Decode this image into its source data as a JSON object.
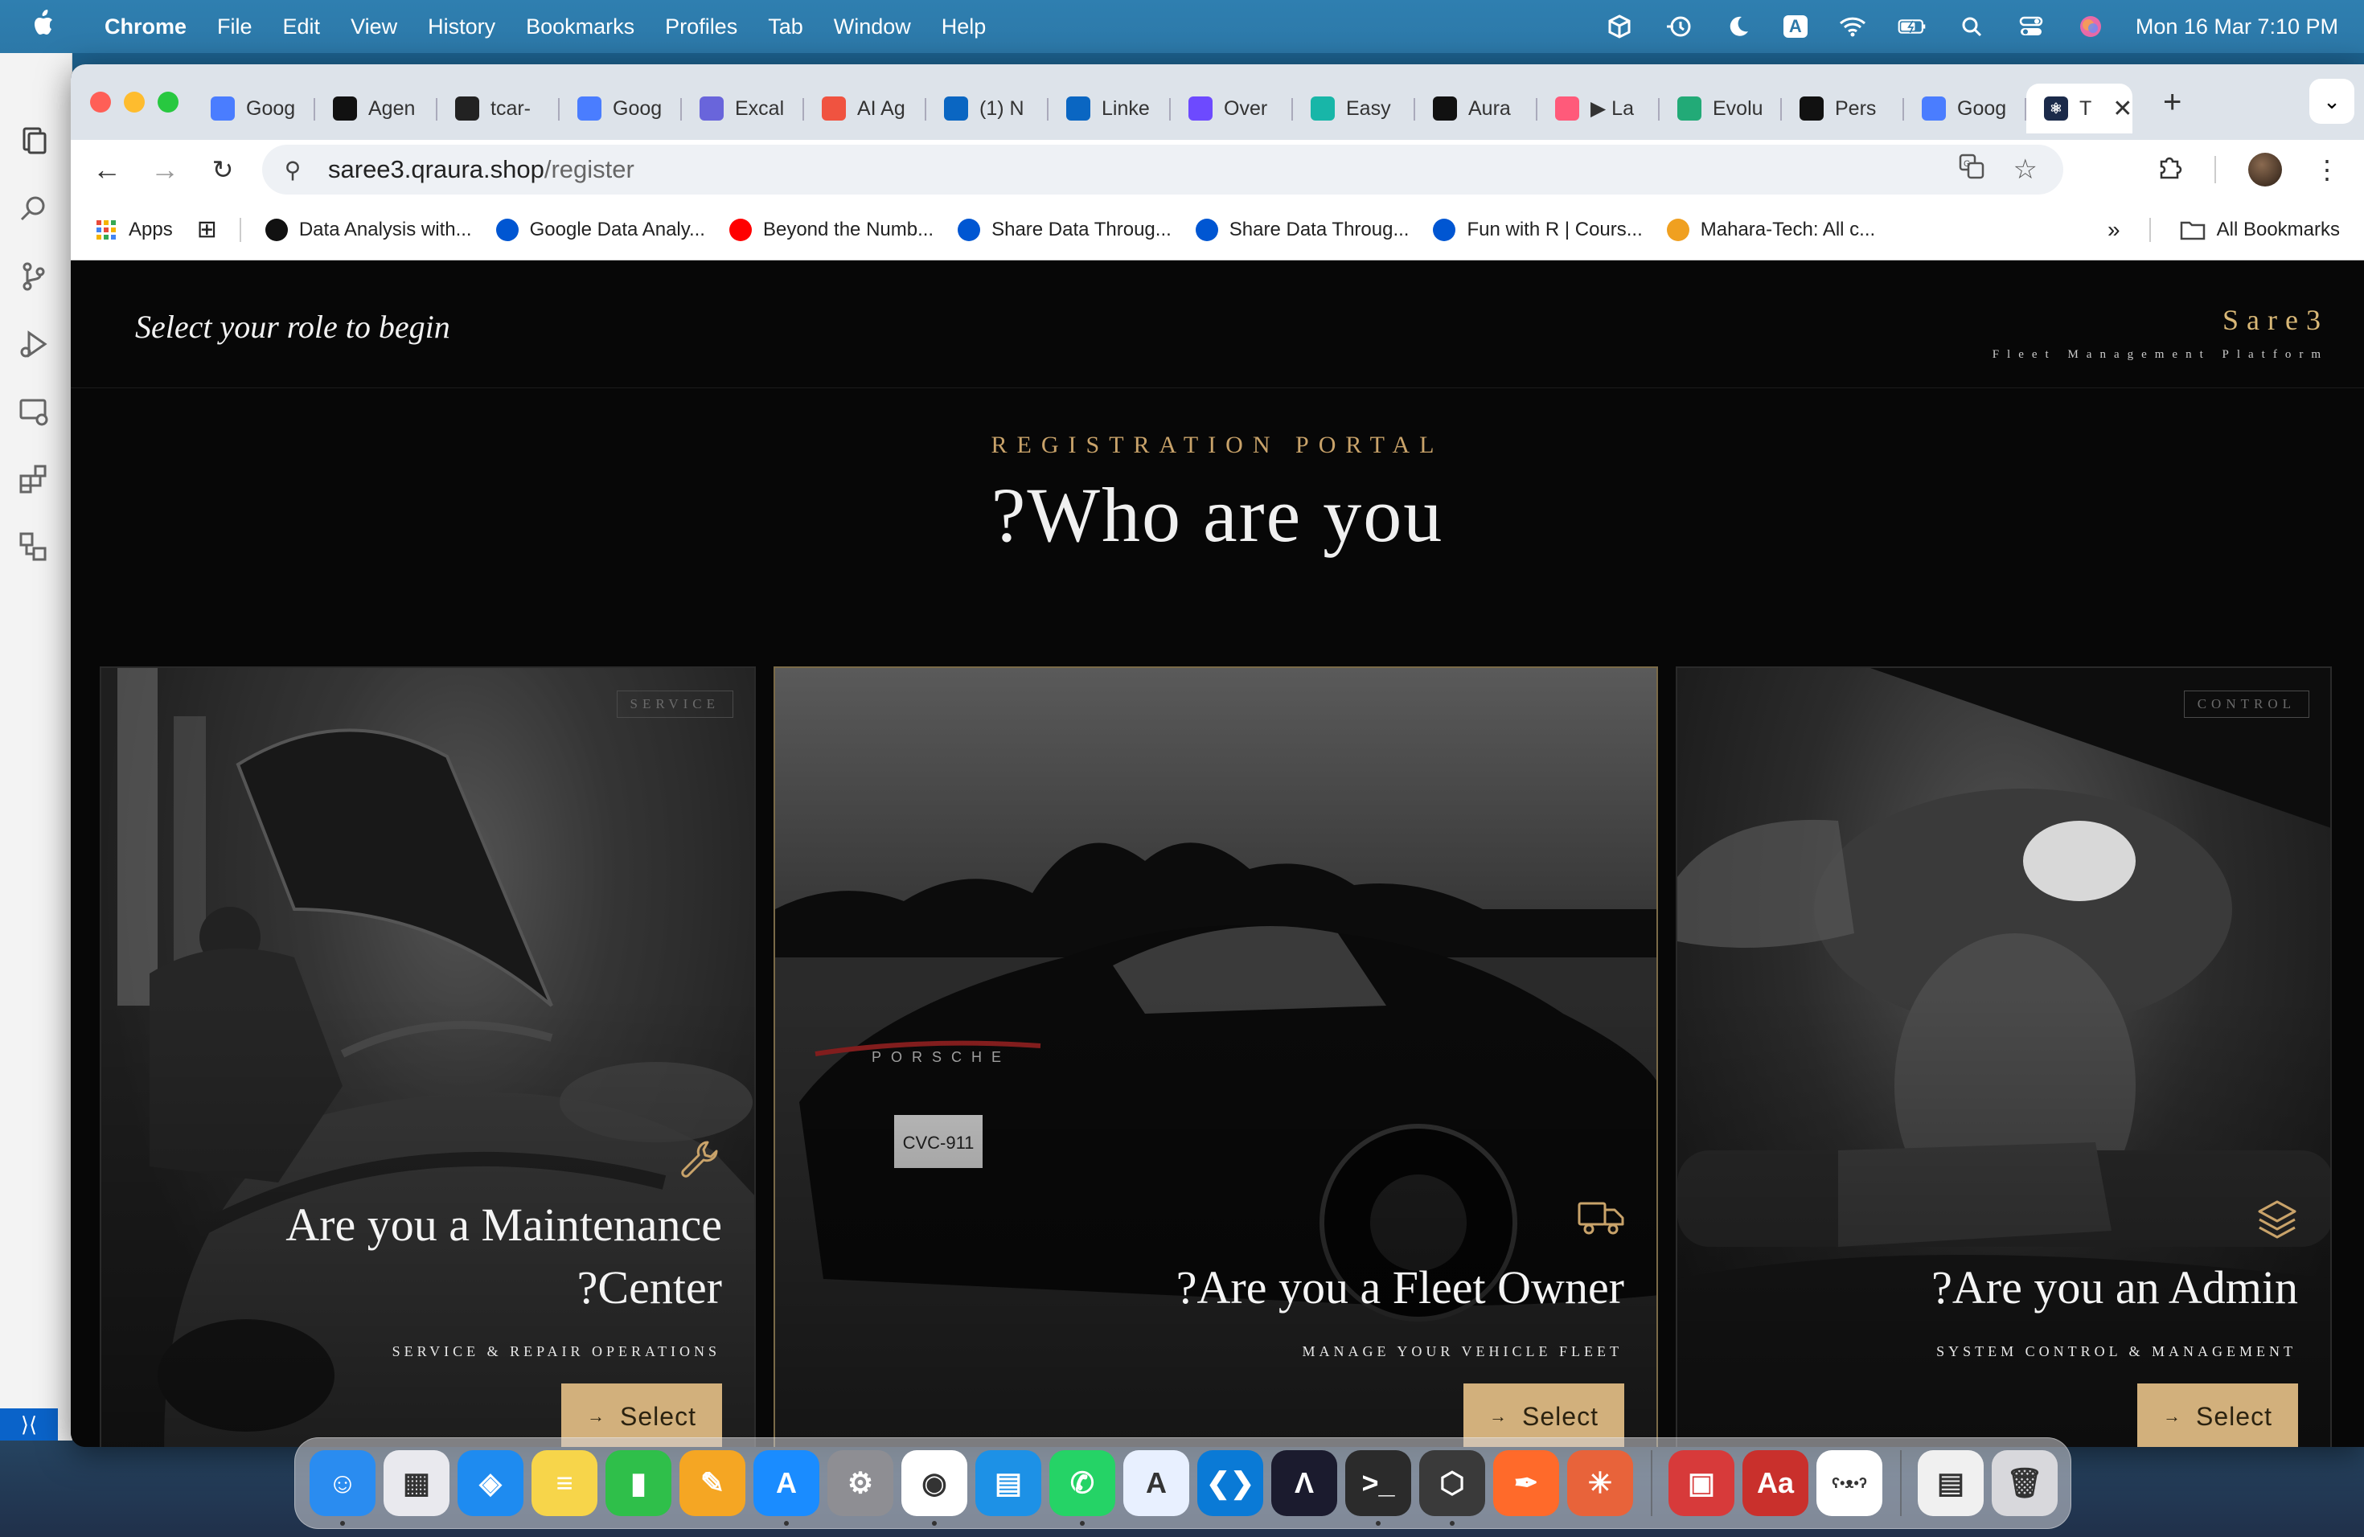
{
  "menubar": {
    "app_name": "Chrome",
    "items": [
      "File",
      "Edit",
      "View",
      "History",
      "Bookmarks",
      "Profiles",
      "Tab",
      "Window",
      "Help"
    ],
    "input_indicator": "A",
    "datetime": "Mon 16 Mar  7:10 PM"
  },
  "tabs": [
    {
      "label": "Goog",
      "icon": "gemini-icon",
      "color": "#4a7dff"
    },
    {
      "label": "Agen",
      "icon": "triangle-logo-icon",
      "color": "#111111"
    },
    {
      "label": "tcar-",
      "icon": "stripes-icon",
      "color": "#222222"
    },
    {
      "label": "Goog",
      "icon": "gemini-icon",
      "color": "#4a7dff"
    },
    {
      "label": "Excal",
      "icon": "excalidraw-icon",
      "color": "#6965db"
    },
    {
      "label": "AI Ag",
      "icon": "laravel-icon",
      "color": "#f05340"
    },
    {
      "label": "(1) N",
      "icon": "linkedin-icon",
      "color": "#0a66c2"
    },
    {
      "label": "Linke",
      "icon": "linkedin-icon",
      "color": "#0a66c2"
    },
    {
      "label": "Over",
      "icon": "make-icon",
      "color": "#6d4aff"
    },
    {
      "label": "Easy",
      "icon": "easy-icon",
      "color": "#18b6a8"
    },
    {
      "label": "Aura",
      "icon": "triangle-logo-icon",
      "color": "#111111"
    },
    {
      "label": "▶ La",
      "icon": "link-icon",
      "color": "#ff5a7a"
    },
    {
      "label": "Evolu",
      "icon": "evolu-icon",
      "color": "#22aa77"
    },
    {
      "label": "Pers",
      "icon": "github-icon",
      "color": "#111111"
    },
    {
      "label": "Goog",
      "icon": "gemini-icon",
      "color": "#4a7dff"
    }
  ],
  "active_tab": {
    "label": "T",
    "icon": "react-icon",
    "color": "#1b2a4a"
  },
  "address": {
    "domain": "saree3.qraura.shop",
    "path": "/register"
  },
  "bookmarks": [
    {
      "label": "Apps",
      "icon": "apps-grid-icon",
      "color": "#e84a3a"
    },
    {
      "label": "Data Analysis with...",
      "icon": "data-analysis-icon",
      "color": "#111111"
    },
    {
      "label": "Google Data Analy...",
      "icon": "coursera-icon",
      "color": "#0056d2"
    },
    {
      "label": "Beyond the Numb...",
      "icon": "youtube-icon",
      "color": "#ff0000"
    },
    {
      "label": "Share Data Throug...",
      "icon": "coursera-icon",
      "color": "#0056d2"
    },
    {
      "label": "Share Data Throug...",
      "icon": "coursera-icon",
      "color": "#0056d2"
    },
    {
      "label": "Fun with R | Cours...",
      "icon": "coursera-icon",
      "color": "#0056d2"
    },
    {
      "label": "Mahara-Tech: All c...",
      "icon": "mahara-icon",
      "color": "#f0a020"
    }
  ],
  "all_bookmarks": "All Bookmarks",
  "page": {
    "tagline": "Select your role to begin",
    "brand_name": "Sare3",
    "brand_sub": "Fleet Management Platform",
    "kicker": "REGISTRATION PORTAL",
    "headline": "?Who are you",
    "accent": "#d2b07c"
  },
  "cards": [
    {
      "badge": "SERVICE",
      "title_line1": "Are you a Maintenance",
      "title_line2": "?Center",
      "subtitle": "SERVICE & REPAIR OPERATIONS",
      "button": "Select",
      "icon": "wrench-icon"
    },
    {
      "badge": "",
      "title_line1": "?Are you a Fleet Owner",
      "title_line2": "",
      "subtitle": "MANAGE YOUR VEHICLE FLEET",
      "button": "Select",
      "icon": "truck-icon"
    },
    {
      "badge": "CONTROL",
      "title_line1": "?Are you an Admin",
      "title_line2": "",
      "subtitle": "SYSTEM CONTROL & MANAGEMENT",
      "button": "Select",
      "icon": "layers-icon"
    }
  ],
  "dock": [
    {
      "name": "finder-icon",
      "color": "#2a8cf0",
      "glyph": "☺"
    },
    {
      "name": "launchpad-icon",
      "color": "#e9e9ee",
      "glyph": "▦"
    },
    {
      "name": "safari-icon",
      "color": "#1e8bf0",
      "glyph": "◈"
    },
    {
      "name": "notes-icon",
      "color": "#f7d54a",
      "glyph": "≡"
    },
    {
      "name": "numbers-icon",
      "color": "#2fbf4a",
      "glyph": "▮"
    },
    {
      "name": "pages-icon",
      "color": "#f5a623",
      "glyph": "✎"
    },
    {
      "name": "app-store-icon",
      "color": "#1a8cff",
      "glyph": "A"
    },
    {
      "name": "system-settings-icon",
      "color": "#8e8e93",
      "glyph": "⚙"
    },
    {
      "name": "chrome-icon",
      "color": "#ffffff",
      "glyph": "◉"
    },
    {
      "name": "docker-icon",
      "color": "#1d91e6",
      "glyph": "▤"
    },
    {
      "name": "whatsapp-icon",
      "color": "#25d366",
      "glyph": "✆"
    },
    {
      "name": "xcode-instruments-icon",
      "color": "#e8f0ff",
      "glyph": "A"
    },
    {
      "name": "vscode-icon",
      "color": "#0a7ad6",
      "glyph": "❮❯"
    },
    {
      "name": "arc-icon",
      "color": "#1b1b2e",
      "glyph": "Λ"
    },
    {
      "name": "terminal-icon",
      "color": "#2b2b2b",
      "glyph": ">_"
    },
    {
      "name": "cube-app-icon",
      "color": "#3a3a3a",
      "glyph": "⬡"
    },
    {
      "name": "vectornator-icon",
      "color": "#ff6a2a",
      "glyph": "✒"
    },
    {
      "name": "claude-icon",
      "color": "#e8633a",
      "glyph": "✳"
    },
    {
      "name": "photo-booth-icon",
      "color": "#d73a3a",
      "glyph": "▣"
    },
    {
      "name": "dictionary-icon",
      "color": "#c9302c",
      "glyph": "Aa"
    },
    {
      "name": "ollama-icon",
      "color": "#ffffff",
      "glyph": "ʕ•ᴥ•ʔ"
    },
    {
      "name": "document-stack-icon",
      "color": "#f0f0f0",
      "glyph": "▤"
    },
    {
      "name": "trash-icon",
      "color": "#d8d8dc",
      "glyph": "🗑"
    }
  ]
}
